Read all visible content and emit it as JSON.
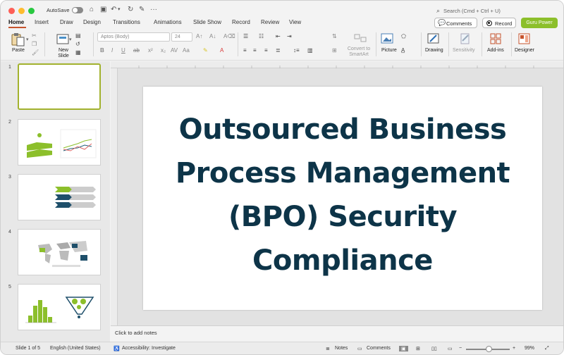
{
  "titlebar": {
    "autosave_label": "AutoSave",
    "search_placeholder": "Search (Cmd + Ctrl + U)"
  },
  "tabs": [
    "Home",
    "Insert",
    "Draw",
    "Design",
    "Transitions",
    "Animations",
    "Slide Show",
    "Record",
    "Review",
    "View"
  ],
  "actions": {
    "comments": "Comments",
    "record": "Record",
    "guru": "Guru Power"
  },
  "ribbon": {
    "paste": "Paste",
    "new_slide": "New Slide",
    "font_name": "Aptos (Body)",
    "font_size": "24",
    "convert_smartart": "Convert to SmartArt",
    "picture": "Picture",
    "drawing": "Drawing",
    "sensitivity": "Sensitivity",
    "addins": "Add-ins",
    "designer": "Designer"
  },
  "slides": [
    {
      "number": "1"
    },
    {
      "number": "2"
    },
    {
      "number": "3"
    },
    {
      "number": "4"
    },
    {
      "number": "5"
    }
  ],
  "slide": {
    "title_lines": [
      "Outsourced Business",
      "Process Management",
      "(BPO) Security",
      "Compliance"
    ]
  },
  "notes_placeholder": "Click to add notes",
  "status": {
    "slide_of": "Slide 1 of 5",
    "language": "English (United States)",
    "accessibility": "Accessibility: Investigate",
    "notes": "Notes",
    "comments": "Comments",
    "zoom": "99%"
  },
  "colors": {
    "accent_green": "#8cbf2b",
    "title_navy": "#0d3448",
    "tab_underline": "#c6532c"
  }
}
